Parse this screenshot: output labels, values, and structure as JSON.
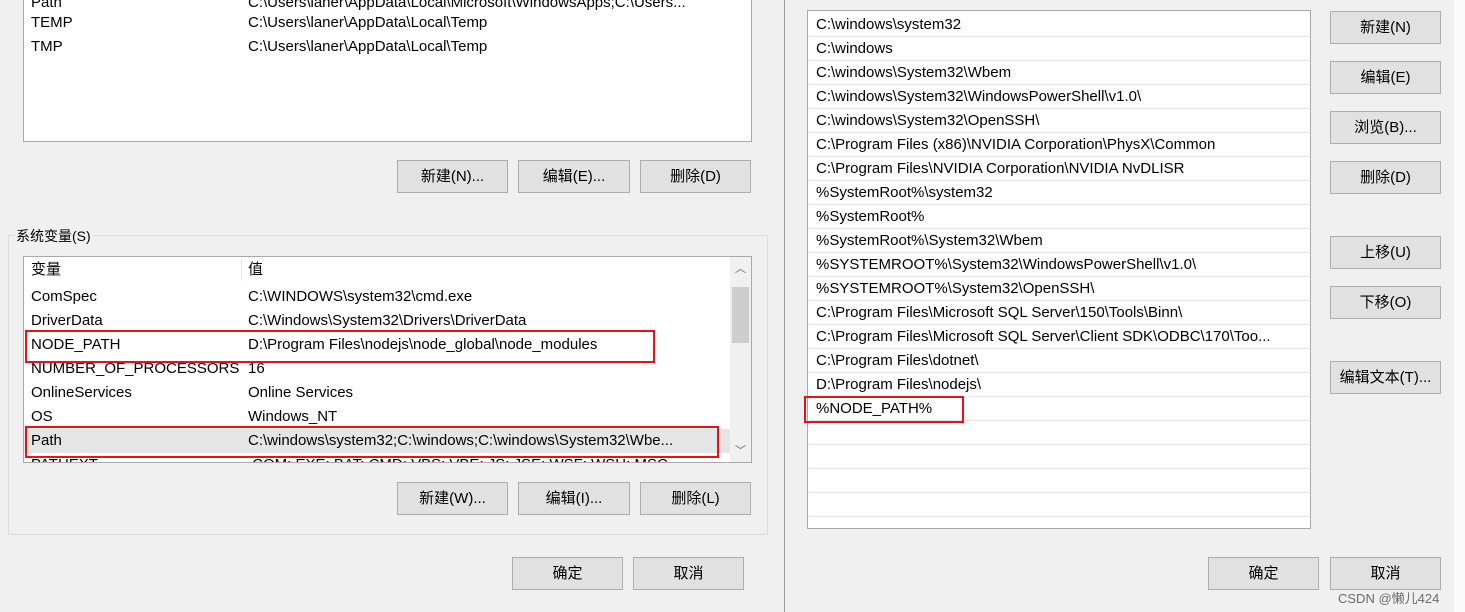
{
  "user_vars": {
    "rows": [
      {
        "name": "Path",
        "value": "C:\\Users\\laner\\AppData\\Local\\Microsoft\\WindowsApps;C:\\Users..."
      },
      {
        "name": "TEMP",
        "value": "C:\\Users\\laner\\AppData\\Local\\Temp"
      },
      {
        "name": "TMP",
        "value": "C:\\Users\\laner\\AppData\\Local\\Temp"
      }
    ],
    "buttons": {
      "new": "新建(N)...",
      "edit": "编辑(E)...",
      "delete": "删除(D)"
    }
  },
  "system_vars": {
    "title": "系统变量(S)",
    "headers": {
      "name": "变量",
      "value": "值"
    },
    "rows": [
      {
        "name": "ComSpec",
        "value": "C:\\WINDOWS\\system32\\cmd.exe"
      },
      {
        "name": "DriverData",
        "value": "C:\\Windows\\System32\\Drivers\\DriverData"
      },
      {
        "name": "NODE_PATH",
        "value": "D:\\Program Files\\nodejs\\node_global\\node_modules"
      },
      {
        "name": "NUMBER_OF_PROCESSORS",
        "value": "16"
      },
      {
        "name": "OnlineServices",
        "value": "Online Services"
      },
      {
        "name": "OS",
        "value": "Windows_NT"
      },
      {
        "name": "Path",
        "value": "C:\\windows\\system32;C:\\windows;C:\\windows\\System32\\Wbe..."
      },
      {
        "name": "PATHEXT",
        "value": ".COM;.EXE;.BAT;.CMD;.VBS;.VBE;.JS;.JSE;.WSF;.WSH;.MSC"
      }
    ],
    "buttons": {
      "new": "新建(W)...",
      "edit": "编辑(I)...",
      "delete": "删除(L)"
    }
  },
  "left_footer": {
    "ok": "确定",
    "cancel": "取消"
  },
  "path_editor": {
    "entries": [
      "C:\\windows\\system32",
      "C:\\windows",
      "C:\\windows\\System32\\Wbem",
      "C:\\windows\\System32\\WindowsPowerShell\\v1.0\\",
      "C:\\windows\\System32\\OpenSSH\\",
      "C:\\Program Files (x86)\\NVIDIA Corporation\\PhysX\\Common",
      "C:\\Program Files\\NVIDIA Corporation\\NVIDIA NvDLISR",
      "%SystemRoot%\\system32",
      "%SystemRoot%",
      "%SystemRoot%\\System32\\Wbem",
      "%SYSTEMROOT%\\System32\\WindowsPowerShell\\v1.0\\",
      "%SYSTEMROOT%\\System32\\OpenSSH\\",
      "C:\\Program Files\\Microsoft SQL Server\\150\\Tools\\Binn\\",
      "C:\\Program Files\\Microsoft SQL Server\\Client SDK\\ODBC\\170\\Too...",
      "C:\\Program Files\\dotnet\\",
      "D:\\Program Files\\nodejs\\",
      "%NODE_PATH%"
    ],
    "buttons": {
      "new": "新建(N)",
      "edit": "编辑(E)",
      "browse": "浏览(B)...",
      "delete": "删除(D)",
      "move_up": "上移(U)",
      "move_down": "下移(O)",
      "edit_text": "编辑文本(T)..."
    },
    "footer": {
      "ok": "确定",
      "cancel": "取消"
    }
  },
  "watermark": "CSDN @懒儿424",
  "colors": {
    "highlight_box": "#e8101a",
    "selected_row": "#e5e5e5"
  }
}
